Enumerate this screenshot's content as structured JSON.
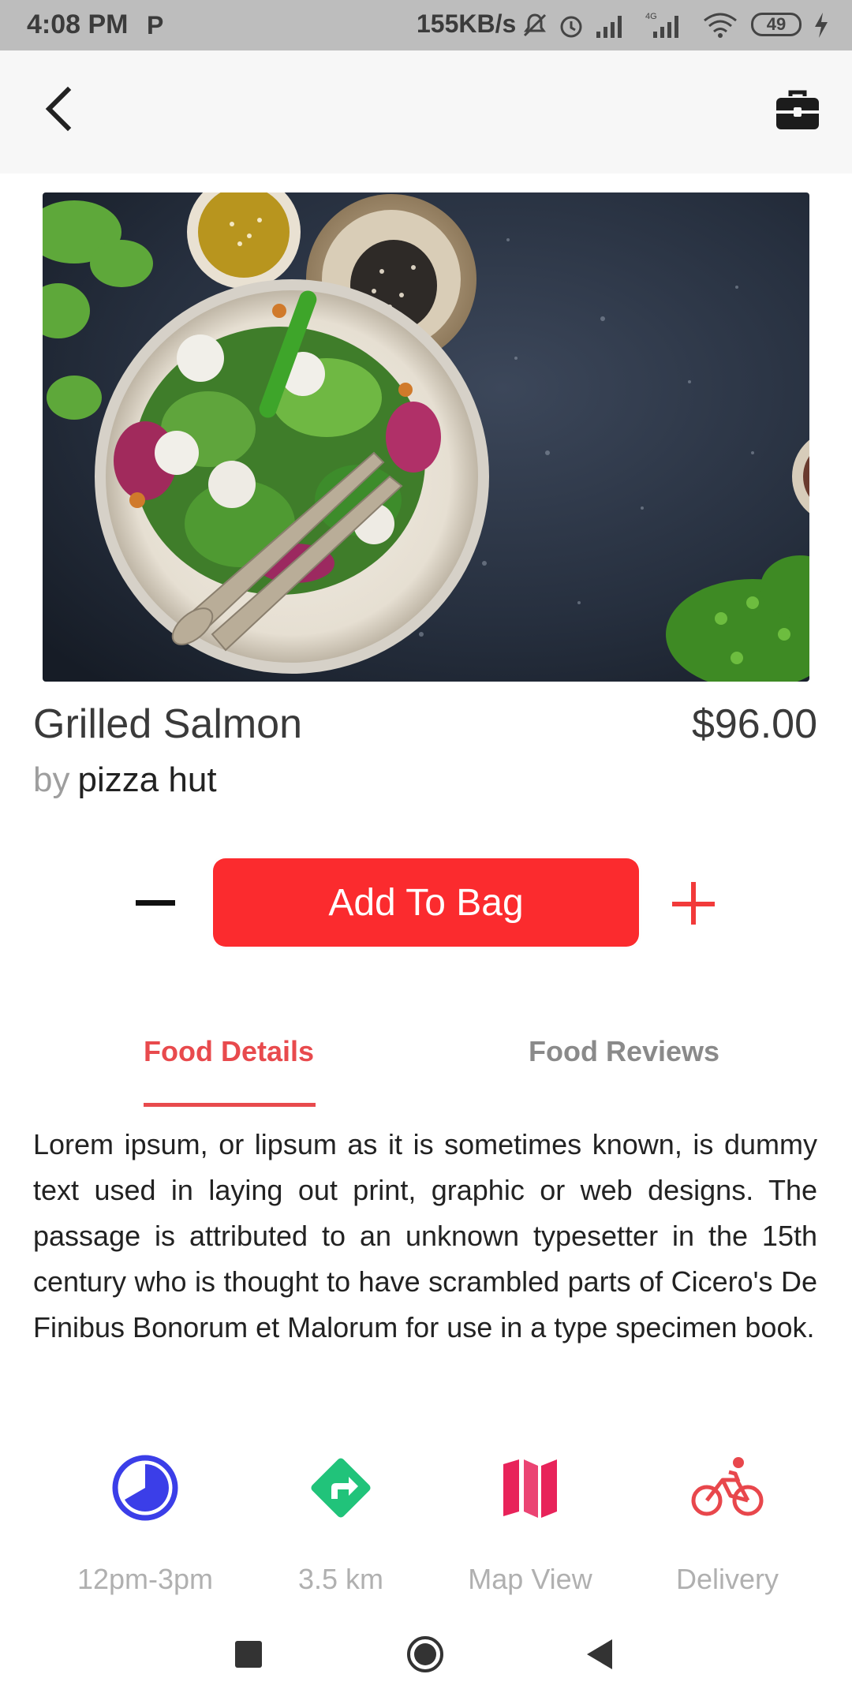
{
  "status_bar": {
    "time": "4:08 PM",
    "app_glyph": "P",
    "speed": "155KB/s",
    "battery": "49",
    "icons": [
      "mute-icon",
      "alarm-icon",
      "signal-icon",
      "signal-4g-icon",
      "wifi-icon",
      "battery-icon",
      "charging-icon"
    ]
  },
  "app_bar": {
    "back_icon": "chevron-left-icon",
    "bag_icon": "briefcase-icon"
  },
  "product": {
    "name": "Grilled Salmon",
    "price": "$96.00",
    "by_prefix": "by",
    "vendor": "pizza hut"
  },
  "actions": {
    "add_to_bag": "Add To Bag"
  },
  "tabs": [
    {
      "label": "Food Details",
      "active": true
    },
    {
      "label": "Food Reviews",
      "active": false
    }
  ],
  "description": "Lorem ipsum, or lipsum as it is sometimes known, is dummy text used in laying out print, graphic or web designs. The passage is attributed to an unknown typesetter in the 15th century who is thought to have scrambled parts of Cicero's De Finibus Bonorum et Malorum for use in a type specimen book.",
  "info_items": [
    {
      "label": "12pm-3pm",
      "icon": "clock-icon",
      "color": "#3b3ee8"
    },
    {
      "label": "3.5 km",
      "icon": "directions-icon",
      "color": "#21c37a"
    },
    {
      "label": "Map View",
      "icon": "map-icon",
      "color": "#e8235a"
    },
    {
      "label": "Delivery",
      "icon": "bicycle-icon",
      "color": "#e8474c"
    }
  ],
  "colors": {
    "accent": "#fb2b2e",
    "tab_active": "#e84a4d"
  }
}
